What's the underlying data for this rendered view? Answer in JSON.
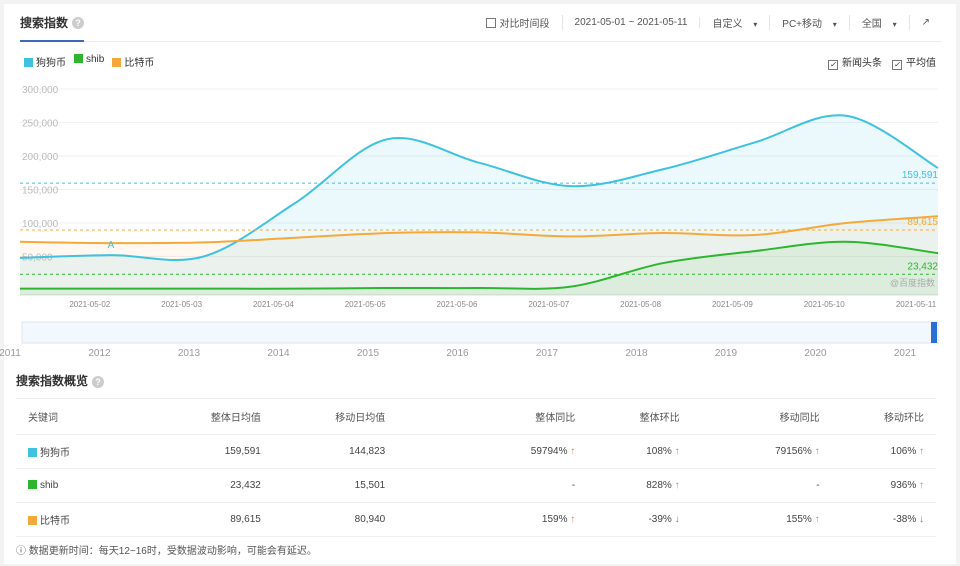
{
  "header": {
    "title": "搜索指数",
    "help": "?",
    "compare_label": "对比时间段",
    "date_range": "2021-05-01 ~ 2021-05-11",
    "custom": "自定义",
    "device": "PC+移动",
    "region": "全国",
    "caret": "▾",
    "export_icon": "↗"
  },
  "legend": [
    {
      "name": "狗狗币",
      "color": "#3fc1e0"
    },
    {
      "name": "shib",
      "color": "#2db52d"
    },
    {
      "name": "比特币",
      "color": "#f5a93a"
    }
  ],
  "options": {
    "news": "新闻头条",
    "average": "平均值",
    "check": "✓"
  },
  "chart_data": {
    "type": "line",
    "x": [
      "2021-05-01",
      "2021-05-02",
      "2021-05-03",
      "2021-05-04",
      "2021-05-05",
      "2021-05-06",
      "2021-05-07",
      "2021-05-08",
      "2021-05-09",
      "2021-05-10",
      "2021-05-11"
    ],
    "xtick_labels": [
      "2021-05-02",
      "2021-05-03",
      "2021-05-04",
      "2021-05-05",
      "2021-05-06",
      "2021-05-07",
      "2021-05-08",
      "2021-05-09",
      "2021-05-10",
      "2021-05-11"
    ],
    "yticks": [
      50000,
      100000,
      150000,
      200000,
      250000,
      300000
    ],
    "ytick_labels": [
      "50,000",
      "100,000",
      "150,000",
      "200,000",
      "250,000",
      "300,000"
    ],
    "ylim": [
      0,
      300000
    ],
    "series": [
      {
        "name": "狗狗币",
        "color": "#3fc1e0",
        "values": [
          48000,
          52000,
          50000,
          130000,
          225000,
          190000,
          155000,
          180000,
          220000,
          260000,
          182000
        ],
        "average": 159591,
        "average_label": "159,591"
      },
      {
        "name": "比特币",
        "color": "#f5a93a",
        "values": [
          72000,
          70000,
          71000,
          78000,
          85000,
          86000,
          80000,
          85000,
          82000,
          100000,
          110000
        ],
        "average": 89615,
        "average_label": "89,615"
      },
      {
        "name": "shib",
        "color": "#2db52d",
        "values": [
          2000,
          2000,
          2000,
          2000,
          3000,
          3000,
          5000,
          40000,
          58000,
          72000,
          55000
        ],
        "average": 23432,
        "average_label": "23,432"
      }
    ],
    "annotation": "A",
    "watermark": "@百度指数",
    "navigator_years": [
      "2011",
      "2012",
      "2013",
      "2014",
      "2015",
      "2016",
      "2017",
      "2018",
      "2019",
      "2020",
      "2021"
    ]
  },
  "overview": {
    "title": "搜索指数概览",
    "columns": [
      "关键词",
      "整体日均值",
      "移动日均值",
      "整体同比",
      "整体环比",
      "移动同比",
      "移动环比"
    ],
    "rows": [
      {
        "kw": "狗狗币",
        "color": "#3fc1e0",
        "c": [
          "159,591",
          "144,823",
          "59794%",
          "108%",
          "79156%",
          "106%"
        ],
        "d": [
          "",
          "",
          "up",
          "up",
          "up",
          "up"
        ]
      },
      {
        "kw": "shib",
        "color": "#2db52d",
        "c": [
          "23,432",
          "15,501",
          "-",
          "828%",
          "-",
          "936%"
        ],
        "d": [
          "",
          "",
          "",
          "up",
          "",
          "up"
        ]
      },
      {
        "kw": "比特币",
        "color": "#f5a93a",
        "c": [
          "89,615",
          "80,940",
          "159%",
          "-39%",
          "155%",
          "-38%"
        ],
        "d": [
          "",
          "",
          "up",
          "down",
          "up",
          "down"
        ]
      }
    ]
  },
  "footer": "ⓘ 数据更新时间：每天12~16时，受数据波动影响，可能会有延迟。"
}
